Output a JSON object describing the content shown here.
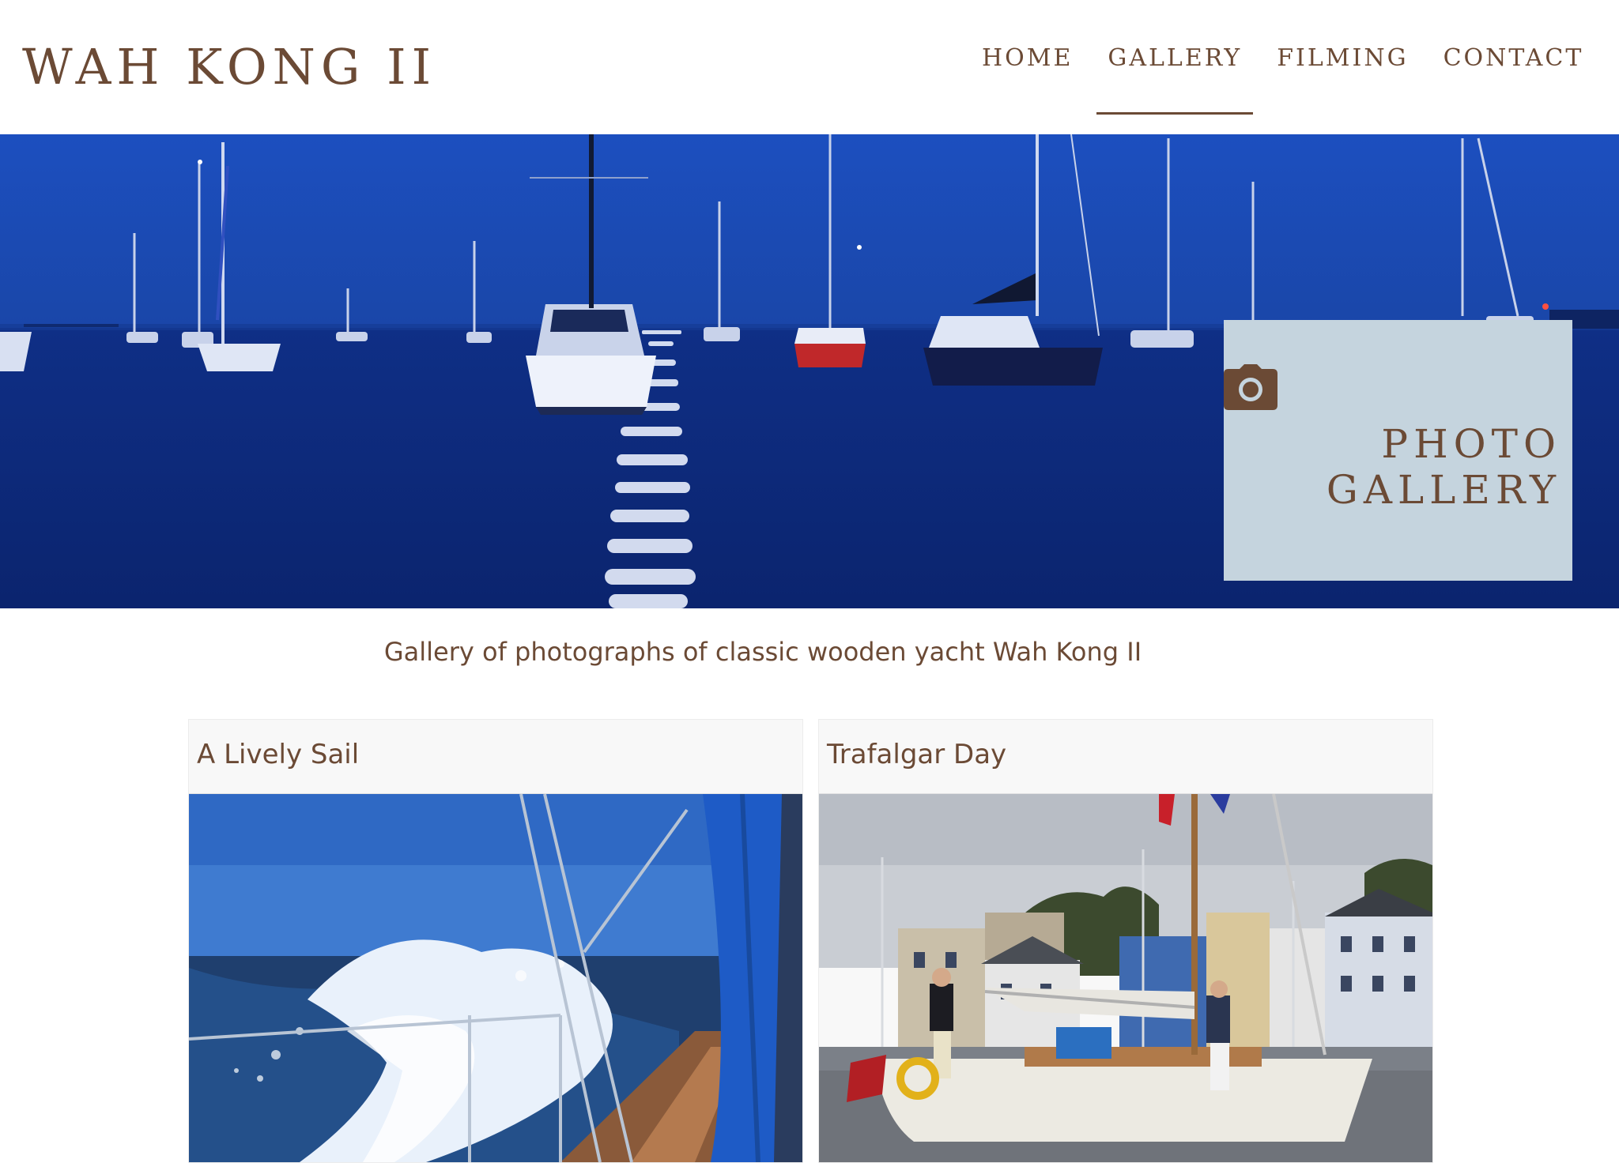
{
  "site": {
    "logo": "WAH KONG II"
  },
  "nav": {
    "items": [
      {
        "label": "HOME"
      },
      {
        "label": "GALLERY"
      },
      {
        "label": "FILMING"
      },
      {
        "label": "CONTACT"
      }
    ],
    "active": "GALLERY"
  },
  "hero": {
    "icon": "camera-icon",
    "title_line1": "PHOTO",
    "title_line2": "GALLERY"
  },
  "intro": {
    "text": "Gallery of photographs of classic wooden yacht Wah Kong II"
  },
  "cards": [
    {
      "title": "A Lively Sail"
    },
    {
      "title": "Trafalgar Day"
    }
  ],
  "colors": {
    "brand_brown": "#6b4a35",
    "hero_box": "#c5d4de",
    "hero_night_blue": "#1b3f9a"
  }
}
